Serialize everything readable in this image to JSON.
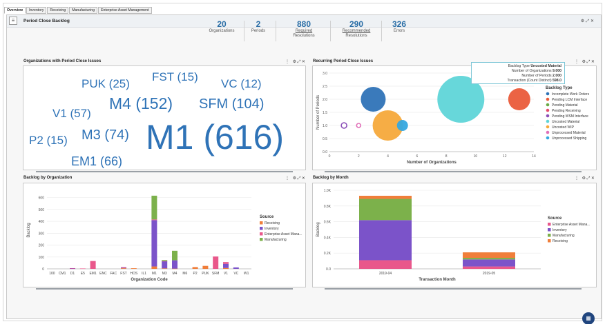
{
  "tabs": [
    "Overview",
    "Inventory",
    "Receiving",
    "Manufacturing",
    "Enterprise Asset Management"
  ],
  "dashboard": {
    "title": "Period Close Backlog",
    "icons": [
      "gear-icon",
      "expand-icon",
      "close-icon"
    ]
  },
  "kpis": [
    {
      "value": "20",
      "label": "Organizations",
      "label2": ""
    },
    {
      "value": "2",
      "label": "Periods",
      "label2": ""
    },
    {
      "value": "880",
      "label": "Required",
      "label2": "Resolutions"
    },
    {
      "value": "290",
      "label": "Recommended",
      "label2": "Resolutions"
    },
    {
      "value": "326",
      "label": "Errors",
      "label2": ""
    }
  ],
  "panels": {
    "orgs_title": "Organizations with Period Close Issues",
    "recurring_title": "Recurring Period Close Issues",
    "by_org_title": "Backlog by Organization",
    "by_month_title": "Backlog by Month"
  },
  "wordcloud": [
    {
      "text": "PUK (25)"
    },
    {
      "text": "FST (15)"
    },
    {
      "text": "VC (12)"
    },
    {
      "text": "V1 (57)"
    },
    {
      "text": "M4 (152)"
    },
    {
      "text": "SFM (104)"
    },
    {
      "text": "P2 (15)"
    },
    {
      "text": "M3 (74)"
    },
    {
      "text": "M1 (616)"
    },
    {
      "text": "EM1 (66)"
    }
  ],
  "tooltip": {
    "rows": [
      {
        "label": "Backlog Type",
        "value": "Uncosted Material"
      },
      {
        "label": "Number of Organizations",
        "value": "9.000"
      },
      {
        "label": "Number of Periods",
        "value": "2.000"
      },
      {
        "label": "Transaction (Count Distinct)",
        "value": "598.0"
      }
    ]
  },
  "colors": {
    "incomplete_work_orders": "#2f73b7",
    "pending_lcm": "#ea5b3a",
    "pending_material": "#6aaa44",
    "pending_receiving": "#e54d6e",
    "pending_wsm": "#8b4fb8",
    "uncosted_material": "#5fd5d8",
    "uncosted_wip": "#f6a93b",
    "unprocessed_material": "#e06fb8",
    "unprocessed_shipping": "#35a8e0",
    "receiving": "#f07e3a",
    "inventory": "#7b53c9",
    "eam": "#e9588b",
    "manufacturing": "#7cb14b"
  },
  "chart_data": [
    {
      "type": "scatter",
      "title": "Recurring Period Close Issues",
      "xlabel": "Number of Organizations",
      "ylabel": "Number of Periods",
      "xlim": [
        0,
        14
      ],
      "ylim": [
        0,
        3
      ],
      "xticks": [
        "0",
        "2",
        "4",
        "6",
        "8",
        "10",
        "12",
        "14"
      ],
      "yticks": [
        "0.0",
        "0.5",
        "1.0",
        "1.5",
        "2.0",
        "2.5",
        "3.0"
      ],
      "legend_title": "Backlog Type",
      "legend_position": "right",
      "series": [
        {
          "name": "Incomplete Work Orders",
          "x": 3,
          "y": 2,
          "size": 18,
          "color": "#2f73b7"
        },
        {
          "name": "Pending LCM Interface",
          "x": 13,
          "y": 2,
          "size": 16,
          "color": "#ea5b3a"
        },
        {
          "name": "Pending Material",
          "x": null,
          "y": null,
          "size": 0,
          "color": "#6aaa44"
        },
        {
          "name": "Pending Receiving",
          "x": null,
          "y": null,
          "size": 0,
          "color": "#e54d6e"
        },
        {
          "name": "Pending WSM Interface",
          "x": 1,
          "y": 1,
          "size": 4,
          "color": "#8b4fb8"
        },
        {
          "name": "Uncosted Material",
          "x": 9,
          "y": 2,
          "size": 34,
          "color": "#5fd5d8"
        },
        {
          "name": "Uncosted WIP",
          "x": 4,
          "y": 1,
          "size": 22,
          "color": "#f6a93b"
        },
        {
          "name": "Unprocessed Material",
          "x": 2,
          "y": 1,
          "size": 3,
          "color": "#e06fb8"
        },
        {
          "name": "Unprocessed Shipping",
          "x": 5,
          "y": 1,
          "size": 8,
          "color": "#35a8e0"
        }
      ]
    },
    {
      "type": "bar",
      "title": "Backlog by Organization",
      "xlabel": "Organization Code",
      "ylabel": "Backlog",
      "ylim": [
        0,
        650
      ],
      "yticks": [
        "0",
        "100",
        "200",
        "300",
        "400",
        "500",
        "600"
      ],
      "legend_title": "Source",
      "legend_position": "right",
      "categories": [
        "100",
        "CM1",
        "D1",
        "E5",
        "EM1",
        "ENC",
        "FAC",
        "FST",
        "HOS",
        "IL1",
        "M1",
        "M3",
        "M4",
        "M6",
        "P2",
        "PUK",
        "SFM",
        "V1",
        "VC",
        "W1"
      ],
      "series": [
        {
          "name": "Receiving",
          "color": "#f07e3a",
          "values": [
            0,
            0,
            0,
            0,
            0,
            0,
            0,
            5,
            5,
            0,
            20,
            4,
            2,
            0,
            15,
            25,
            0,
            7,
            0,
            0
          ]
        },
        {
          "name": "Inventory",
          "color": "#7b53c9",
          "values": [
            0,
            0,
            3,
            0,
            0,
            0,
            0,
            5,
            0,
            0,
            390,
            60,
            70,
            0,
            0,
            0,
            0,
            35,
            12,
            0
          ]
        },
        {
          "name": "Enterprise Asset Mana...",
          "color": "#e9588b",
          "values": [
            0,
            0,
            3,
            3,
            66,
            0,
            0,
            5,
            0,
            0,
            6,
            2,
            0,
            0,
            0,
            0,
            104,
            15,
            0,
            0
          ]
        },
        {
          "name": "Manufacturing",
          "color": "#7cb14b",
          "values": [
            0,
            0,
            0,
            0,
            0,
            0,
            0,
            0,
            0,
            0,
            200,
            8,
            80,
            0,
            0,
            0,
            0,
            0,
            0,
            0
          ]
        }
      ]
    },
    {
      "type": "bar",
      "title": "Backlog by Month",
      "xlabel": "Transaction Month",
      "ylabel": "Backlog",
      "ylim": [
        0,
        1000
      ],
      "yticks": [
        "0.0",
        "0.2K",
        "0.4K",
        "0.6K",
        "0.8K",
        "1.0K"
      ],
      "legend_title": "Source",
      "legend_position": "right",
      "categories": [
        "2019-04",
        "2019-05"
      ],
      "series": [
        {
          "name": "Enterprise Asset Mana...",
          "color": "#e9588b",
          "values": [
            110,
            30
          ]
        },
        {
          "name": "Inventory",
          "color": "#7b53c9",
          "values": [
            510,
            90
          ]
        },
        {
          "name": "Manufacturing",
          "color": "#7cb14b",
          "values": [
            270,
            20
          ]
        },
        {
          "name": "Receiving",
          "color": "#f07e3a",
          "values": [
            40,
            70
          ]
        }
      ]
    }
  ]
}
